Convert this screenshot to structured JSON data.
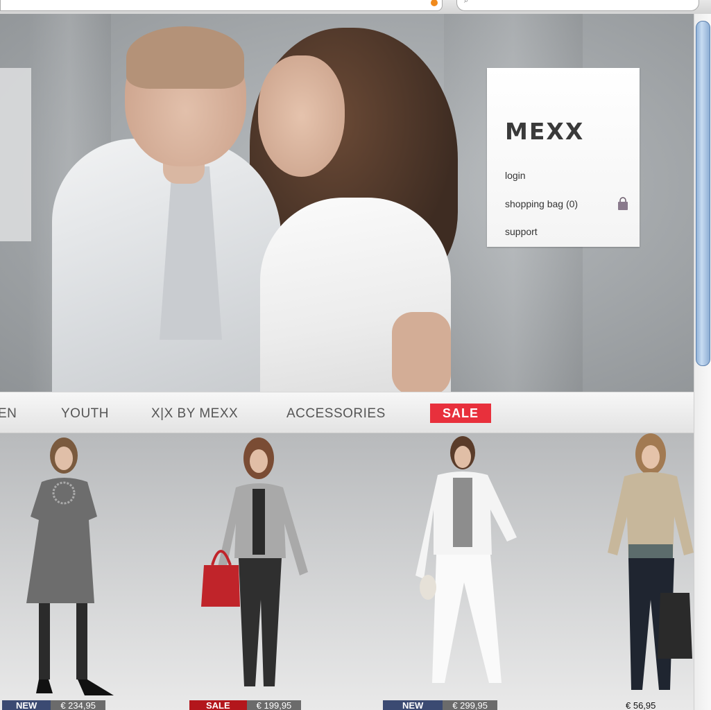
{
  "brand": {
    "logo_text": "MEXX"
  },
  "account_menu": {
    "login": "login",
    "shopping_bag": "shopping bag (0)",
    "support": "support"
  },
  "nav": {
    "items": [
      "EN",
      "YOUTH",
      "X|X BY MEXX",
      "ACCESSORIES"
    ],
    "sale": "SALE"
  },
  "products": [
    {
      "badge": "NEW",
      "price": "€ 234,95",
      "badge_color": "#3b4a72"
    },
    {
      "badge": "SALE",
      "price": "€ 199,95",
      "badge_color": "#b3161c"
    },
    {
      "badge": "NEW",
      "price": "€ 299,95",
      "badge_color": "#3b4a72"
    },
    {
      "badge": "",
      "price": "€ 56,95",
      "badge_color": ""
    }
  ],
  "colors": {
    "sale_red": "#e8303c",
    "nav_text": "#555555"
  }
}
